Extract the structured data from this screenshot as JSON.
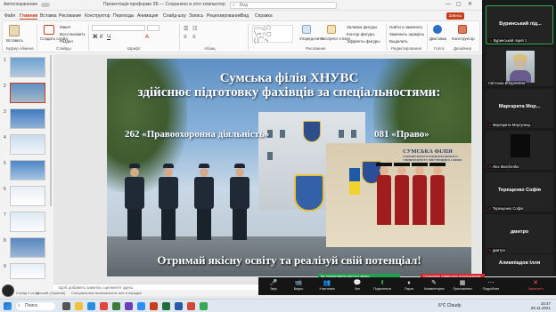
{
  "titlebar": {
    "file_label": "Файл",
    "filename": "Презентація проформи ЗБ — Сохранено в этот компьютер",
    "search_placeholder": "Вид",
    "autosave": "Автосохранение"
  },
  "tabs": [
    "Файл",
    "Главная",
    "Вставка",
    "Рисование",
    "Конструктор",
    "Переходы",
    "Анимация",
    "Слайд-шоу",
    "Запись",
    "Рецензирование",
    "Вид",
    "Справка"
  ],
  "share_label": "Запись",
  "ribbon": {
    "groups": [
      "Буфер обмена",
      "Слайды",
      "Шрифт",
      "Абзац",
      "Рисование",
      "Редактирование",
      "Голос",
      "Дизайнер"
    ],
    "buttons": {
      "paste": "Вставить",
      "new_slide": "Создать слайд",
      "layout": "Макет",
      "reset": "Восстановить",
      "section": "Раздел",
      "arrange": "Упорядочить",
      "quick_styles": "Экспресс-стили",
      "shape_fill": "Заливка фигуры",
      "shape_outline": "Контур фигуры",
      "shape_effects": "Эффекты фигуры",
      "find": "Найти и заменить",
      "replace": "Заменить шрифты",
      "select": "Выделить",
      "dictate": "Диктовка",
      "designer": "Конструктор"
    }
  },
  "thumbnails": [
    "1",
    "2",
    "3",
    "4",
    "5",
    "6",
    "7",
    "8",
    "9"
  ],
  "slide": {
    "title_line1": "Сумська філія ХНУВС",
    "title_line2": "здійснює підготовку фахівців за спеціальностями:",
    "spec_left": "262 «Правоохоронна діяльність»",
    "spec_right": "081 «Право»",
    "bottom": "Отримай якісну освіту та реалізуй свій потенціал!",
    "photo_label_line1": "СУМСЬКА ФІЛІЯ",
    "photo_label_line2": "ХАРКІВСЬКОГО НАЦІОНАЛЬНОГО УНІВЕРСИТЕТУ ВНУТРІШНІХ СПРАВ"
  },
  "notes_placeholder": "Щоб добавить заметки, щелкните здесь",
  "statusbar": {
    "slide_counter": "Слайд 2 из 16",
    "language": "русский (Украина)",
    "accessibility": "Специальные возможности: все в порядке"
  },
  "participants": [
    {
      "big": "Буринський лід...",
      "small": "Буринський ліцей 1",
      "active": true,
      "video": false
    },
    {
      "big": "",
      "small": "Світлана Богдановна",
      "active": false,
      "video": true
    },
    {
      "big": "Маргарита Мор...",
      "small": "Маргарита Моргунець",
      "active": false,
      "video": false
    },
    {
      "big": "",
      "small": "Alex Marchenko",
      "active": false,
      "video": false
    },
    {
      "big": "Терещенко Софія",
      "small": "Терещенко Софія",
      "active": false,
      "video": false
    },
    {
      "big": "дмитро",
      "small": "дмитро",
      "active": false,
      "video": false
    },
    {
      "big": "Алимпіадов Ілля",
      "small": "",
      "active": false,
      "video": false
    }
  ],
  "banners": {
    "green": "Вы предоставили доступ к экрану",
    "red": "Остановить совместное использование"
  },
  "zoom_toolbar": [
    {
      "icon": "mic-icon",
      "glyph": "🎤",
      "label": "Звук"
    },
    {
      "icon": "video-icon",
      "glyph": "📹",
      "label": "Видео"
    },
    {
      "icon": "participants-icon",
      "glyph": "👥",
      "label": "Участники"
    },
    {
      "icon": "chat-icon",
      "glyph": "💬",
      "label": "Чат"
    },
    {
      "icon": "share-icon",
      "glyph": "⬆",
      "label": "Поделиться"
    },
    {
      "icon": "pause-icon",
      "glyph": "⏸",
      "label": "Пауза"
    },
    {
      "icon": "annotate-icon",
      "glyph": "✎",
      "label": "Комментарии"
    },
    {
      "icon": "apps-icon",
      "glyph": "▦",
      "label": "Приложения"
    },
    {
      "icon": "more-icon",
      "glyph": "⋯",
      "label": "Подробнее"
    },
    {
      "icon": "end-icon",
      "glyph": "✕",
      "label": "Закончить"
    }
  ],
  "taskbar": {
    "search": "Поиск",
    "weather": "6°C Cloudy",
    "time": "15:47",
    "date": "25.11.2021"
  },
  "colors": {
    "accent": "#c43e1c",
    "zoom_green": "#1fa24a",
    "zoom_red": "#d8282d"
  }
}
